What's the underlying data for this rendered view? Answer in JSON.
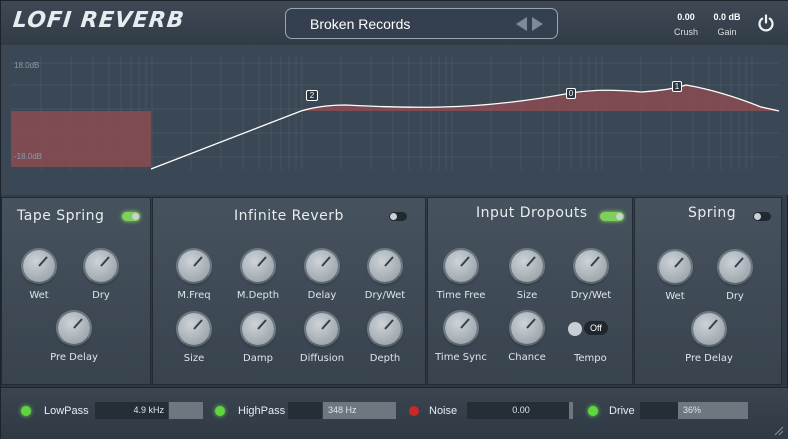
{
  "header": {
    "logo": "LOFI REVERB",
    "preset": "Broken Records",
    "crush": {
      "value": "0.00",
      "label": "Crush"
    },
    "gain": {
      "value": "0.0 dB",
      "label": "Gain"
    }
  },
  "graph": {
    "top_label": "18.0dB",
    "bottom_label": "-18.0dB",
    "nodes": [
      "2",
      "0",
      "1"
    ]
  },
  "panels": {
    "tape_spring": {
      "title": "Tape Spring",
      "enabled": true,
      "knobs": [
        "Wet",
        "Dry",
        "Pre Delay"
      ]
    },
    "infinite_reverb": {
      "title": "Infinite Reverb",
      "enabled": false,
      "knobs": [
        "M.Freq",
        "M.Depth",
        "Delay",
        "Dry/Wet",
        "Size",
        "Damp",
        "Diffusion",
        "Depth"
      ]
    },
    "input_dropouts": {
      "title": "Input Dropouts",
      "enabled": true,
      "knobs": [
        "Time Free",
        "Size",
        "Dry/Wet",
        "Time Sync",
        "Chance"
      ],
      "tempo_label": "Tempo",
      "tempo_state": "Off"
    },
    "spring": {
      "title": "Spring",
      "enabled": false,
      "knobs": [
        "Wet",
        "Dry",
        "Pre Delay"
      ]
    }
  },
  "footer": {
    "lowpass": {
      "label": "LowPass",
      "value": "4.9 kHz",
      "enabled": true
    },
    "highpass": {
      "label": "HighPass",
      "value": "348 Hz",
      "enabled": true
    },
    "noise": {
      "label": "Noise",
      "value": "0.00",
      "enabled": false
    },
    "drive": {
      "label": "Drive",
      "value": "36%",
      "enabled": true
    }
  },
  "colors": {
    "accent_green": "#7fd05a",
    "noise_led": "#c82828",
    "eq_fill": "#8c4c54"
  }
}
